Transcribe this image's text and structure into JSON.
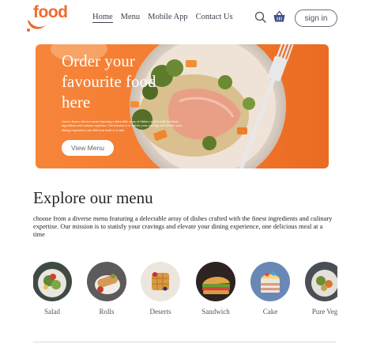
{
  "brand": {
    "logo_text": "food"
  },
  "nav": {
    "items": [
      "Home",
      "Menu",
      "Mobile App",
      "Contact Us"
    ]
  },
  "header": {
    "signin_label": "sign in",
    "search_icon": "search-icon",
    "basket_icon": "basket-icon"
  },
  "hero": {
    "title": "Order your favourite food here",
    "description": "choose from a diverse menu featuring a delectable array of dishes crafted with the finest ingredients and culinary expertise. Our mission is to satisfy your cravings and elevate your dining experience, one delicious meal at a time.",
    "button_label": "View Menu"
  },
  "explore": {
    "title": "Explore our menu",
    "description": "choose from a diverse menu featuring a delectable array of dishes crafted with the finest ingredients and culinary expertise. Our mission is to statisfy your cravings and elevate your dining experience, one delicious meal at a time",
    "categories": [
      "Salad",
      "Rolls",
      "Deserts",
      "Sandwich",
      "Cake",
      "Pure Veg"
    ]
  },
  "colors": {
    "brand": "#ef6a2c",
    "hero_bg": "#f37a2e"
  }
}
